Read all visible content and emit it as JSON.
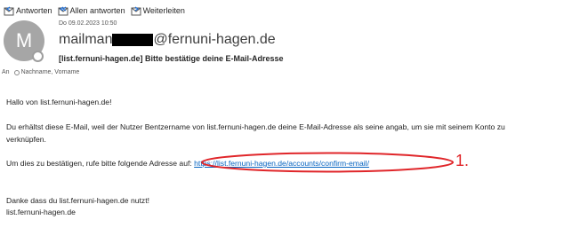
{
  "toolbar": {
    "reply": {
      "label": "Antworten",
      "icon": "reply-icon"
    },
    "reply_all": {
      "label": "Allen antworten",
      "icon": "reply-all-icon"
    },
    "forward": {
      "label": "Weiterleiten",
      "icon": "forward-icon"
    }
  },
  "message": {
    "avatar_initial": "M",
    "date": "Do 09.02.2023 10:50",
    "sender_prefix": "mailman",
    "sender_suffix": "@fernuni-hagen.de",
    "subject": "[list.fernuni-hagen.de] Bitte bestätige deine E-Mail-Adresse",
    "to_label": "An",
    "to_value": "Nachname, Vorname"
  },
  "body": {
    "greeting": "Hallo von list.fernuni-hagen.de!",
    "paragraph1_line1": "Du erhältst diese E-Mail, weil der Nutzer Bentzername  von list.fernuni-hagen.de deine E-Mail-Adresse als seine angab, um sie mit seinem Konto zu",
    "paragraph1_line2": "verknüpfen.",
    "confirm_prefix": "Um dies zu bestätigen, rufe bitte folgende Adresse auf:",
    "confirm_link": "https://list.fernuni-hagen.de/accounts/confirm-email/",
    "thanks": "Danke dass du list.fernuni-hagen.de nutzt!",
    "signature": "list.fernuni-hagen.de"
  },
  "annotation": {
    "number": "1.",
    "color": "#e0262a"
  },
  "colors": {
    "link": "#0563c1",
    "avatar_bg": "#a6a6a6"
  }
}
